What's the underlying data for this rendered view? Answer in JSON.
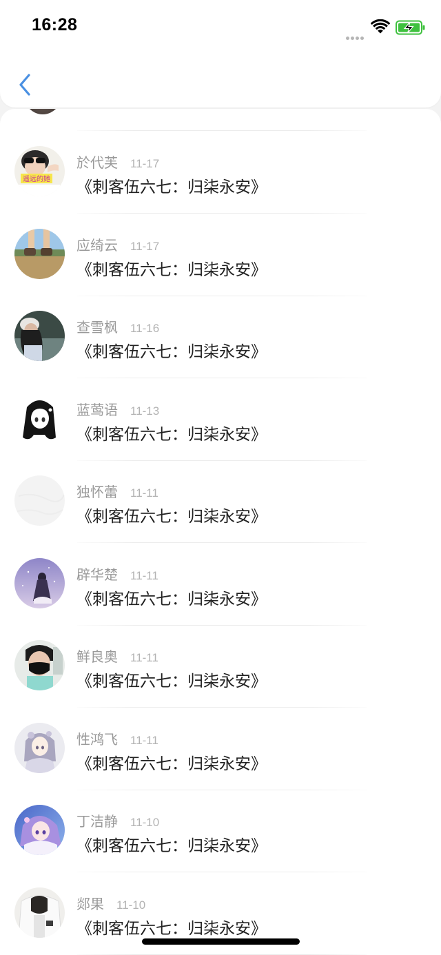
{
  "status_bar": {
    "time": "16:28",
    "battery_color": "#3fc13f"
  },
  "nav": {
    "back_icon": "chevron-left-icon",
    "accent_color": "#4a90e2"
  },
  "comments": [
    {
      "name": "於代芙",
      "date": "11-17",
      "text": "《刺客伍六七：归柒永安》",
      "avatar_label": "遥远的她",
      "avatar_style": "a1"
    },
    {
      "name": "应绮云",
      "date": "11-17",
      "text": "《刺客伍六七：归柒永安》",
      "avatar_style": "a2"
    },
    {
      "name": "查雪枫",
      "date": "11-16",
      "text": "《刺客伍六七：归柒永安》",
      "avatar_style": "a3"
    },
    {
      "name": "蓝莺语",
      "date": "11-13",
      "text": "《刺客伍六七：归柒永安》",
      "avatar_style": "a4"
    },
    {
      "name": "独怀蕾",
      "date": "11-11",
      "text": "《刺客伍六七：归柒永安》",
      "avatar_style": "a5"
    },
    {
      "name": "辟华楚",
      "date": "11-11",
      "text": "《刺客伍六七：归柒永安》",
      "avatar_style": "a6"
    },
    {
      "name": "鲜良奥",
      "date": "11-11",
      "text": "《刺客伍六七：归柒永安》",
      "avatar_style": "a7"
    },
    {
      "name": "性鸿飞",
      "date": "11-11",
      "text": "《刺客伍六七：归柒永安》",
      "avatar_style": "a8"
    },
    {
      "name": "丁洁静",
      "date": "11-10",
      "text": "《刺客伍六七：归柒永安》",
      "avatar_style": "a9"
    },
    {
      "name": "郯果",
      "date": "11-10",
      "text": "《刺客伍六七：归柒永安》",
      "avatar_style": "a10"
    }
  ]
}
